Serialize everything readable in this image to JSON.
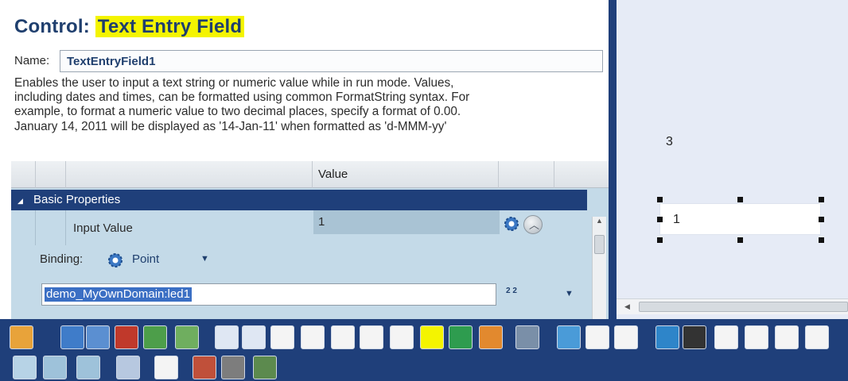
{
  "header": {
    "title_prefix": "Control: ",
    "title_highlight": "Text Entry Field"
  },
  "name": {
    "label": "Name:",
    "value": "TextEntryField1"
  },
  "description": [
    "Enables the user to input a text string or numeric value while in run mode. Values,",
    "including dates and times, can be formatted using common FormatString syntax. For",
    "example, to format a numeric value to two decimal places, specify a format of 0.00.",
    "January 14, 2011 will be displayed as '14-Jan-11' when formatted as 'd-MMM-yy'"
  ],
  "grid": {
    "value_header": "Value",
    "category": {
      "label": "Basic Properties",
      "expand_icon": "triangle-down-icon"
    },
    "property": {
      "name": "Input Value",
      "value": "1"
    },
    "binding": {
      "label": "Binding:",
      "value": "Point"
    },
    "point": {
      "value": "demo_MyOwnDomain:led1",
      "pick_label": "2 2"
    }
  },
  "canvas": {
    "label_text": "3",
    "field_value": "1"
  },
  "colors": {
    "accent_dark": "#1f3f7a",
    "highlight": "#f4f400",
    "title_color": "#1f3f6e",
    "grid_bg": "#c4dae8",
    "canvas_bg": "#e6ebf6"
  },
  "toolbox": {
    "row1": [
      {
        "name": "bell-icon",
        "color": "#e8a33a"
      },
      {
        "name": "window-icon",
        "color": "#3f7cc9"
      },
      {
        "name": "panel-icon",
        "color": "#5b8fd1"
      },
      {
        "name": "bar-chart-icon",
        "color": "#c0392b"
      },
      {
        "name": "trend-chart-icon",
        "color": "#4d9e4a"
      },
      {
        "name": "trend-chart-2-icon",
        "color": "#6fae5f"
      },
      {
        "name": "button-icon",
        "color": "#dfe7f3"
      },
      {
        "name": "button-2-icon",
        "color": "#dfe7f3"
      },
      {
        "name": "checkbox-icon",
        "color": "#f4f4f4"
      },
      {
        "name": "checkbox-2-icon",
        "color": "#f4f4f4"
      },
      {
        "name": "radio-icon",
        "color": "#f4f4f4"
      },
      {
        "name": "label-icon",
        "color": "#f4f4f4"
      },
      {
        "name": "frame-icon",
        "color": "#f4f4f4"
      },
      {
        "name": "text-entry-icon",
        "color": "#2e9c4f"
      },
      {
        "name": "text-entry-2-icon",
        "color": "#2e9c4f"
      },
      {
        "name": "download-icon",
        "color": "#e2892e"
      },
      {
        "name": "phone-icon",
        "color": "#7a8fa8"
      },
      {
        "name": "calendar-icon",
        "color": "#4a9bd8"
      },
      {
        "name": "calendar-15-icon",
        "color": "#f4f4f4"
      },
      {
        "name": "clock-icon",
        "color": "#f4f4f4"
      },
      {
        "name": "gauge-blue-icon",
        "color": "#2e85c9"
      },
      {
        "name": "gauge-dark-icon",
        "color": "#333333"
      },
      {
        "name": "sparkline-icon",
        "color": "#f4f4f4"
      },
      {
        "name": "vertical-slider-icon",
        "color": "#f4f4f4"
      },
      {
        "name": "scatter-chart-icon",
        "color": "#f4f4f4"
      },
      {
        "name": "semicircle-gauge-icon",
        "color": "#f4f4f4"
      },
      {
        "name": "slider-icon",
        "color": "#f4f4f4"
      }
    ],
    "row2": [
      {
        "name": "ellipse-icon",
        "color": "#b7d3e6"
      },
      {
        "name": "rectangle-icon",
        "color": "#9ec2da"
      },
      {
        "name": "rounded-rectangle-icon",
        "color": "#9ec2da"
      },
      {
        "name": "settings-icon",
        "color": "#b7c8e0"
      },
      {
        "name": "text-label-icon",
        "color": "#f4f4f4"
      },
      {
        "name": "led-red-icon",
        "color": "#c0503a"
      },
      {
        "name": "led-grey-icon",
        "color": "#7d7d7d"
      },
      {
        "name": "thermometer-icon",
        "color": "#5c8a4e"
      }
    ]
  }
}
